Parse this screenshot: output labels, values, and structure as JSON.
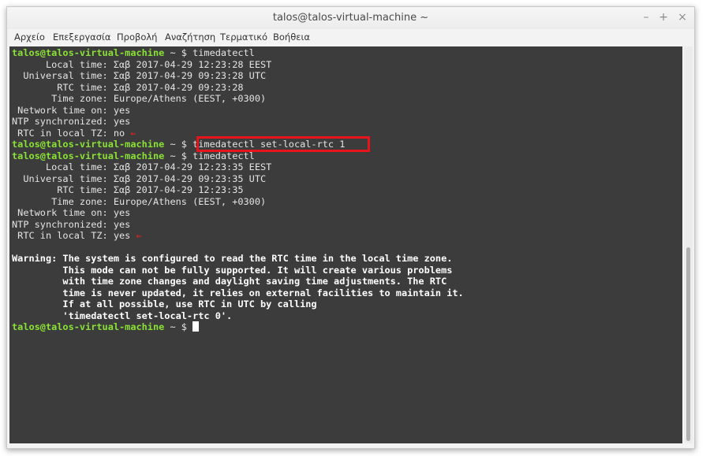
{
  "window": {
    "title": "talos@talos-virtual-machine ~",
    "controls": {
      "minimize": "–",
      "maximize": "+",
      "close": "×"
    }
  },
  "menu": [
    "Αρχείο",
    "Επεξεργασία",
    "Προβολή",
    "Αναζήτηση",
    "Τερματικό",
    "Βοήθεια"
  ],
  "terminal": {
    "prompt": "talos@talos-virtual-machine",
    "prompt_suffix": " ~ $ ",
    "cmd1": "timedatectl",
    "out1": [
      "      Local time: Σαβ 2017-04-29 12:23:28 EEST",
      "  Universal time: Σαβ 2017-04-29 09:23:28 UTC",
      "        RTC time: Σαβ 2017-04-29 09:23:28",
      "       Time zone: Europe/Athens (EEST, +0300)",
      " Network time on: yes",
      "NTP synchronized: yes"
    ],
    "rtc1": " RTC in local TZ: no ",
    "cmd2": "timedatectl set-local-rtc 1",
    "cmd3": "timedatectl",
    "out2": [
      "      Local time: Σαβ 2017-04-29 12:23:35 EEST",
      "  Universal time: Σαβ 2017-04-29 09:23:35 UTC",
      "        RTC time: Σαβ 2017-04-29 12:23:35",
      "       Time zone: Europe/Athens (EEST, +0300)",
      " Network time on: yes",
      "NTP synchronized: yes"
    ],
    "rtc2": " RTC in local TZ: yes ",
    "arrow": "⇐",
    "warning": [
      "Warning: The system is configured to read the RTC time in the local time zone.",
      "         This mode can not be fully supported. It will create various problems",
      "         with time zone changes and daylight saving time adjustments. The RTC",
      "         time is never updated, it relies on external facilities to maintain it.",
      "         If at all possible, use RTC in UTC by calling",
      "         'timedatectl set-local-rtc 0'."
    ]
  }
}
